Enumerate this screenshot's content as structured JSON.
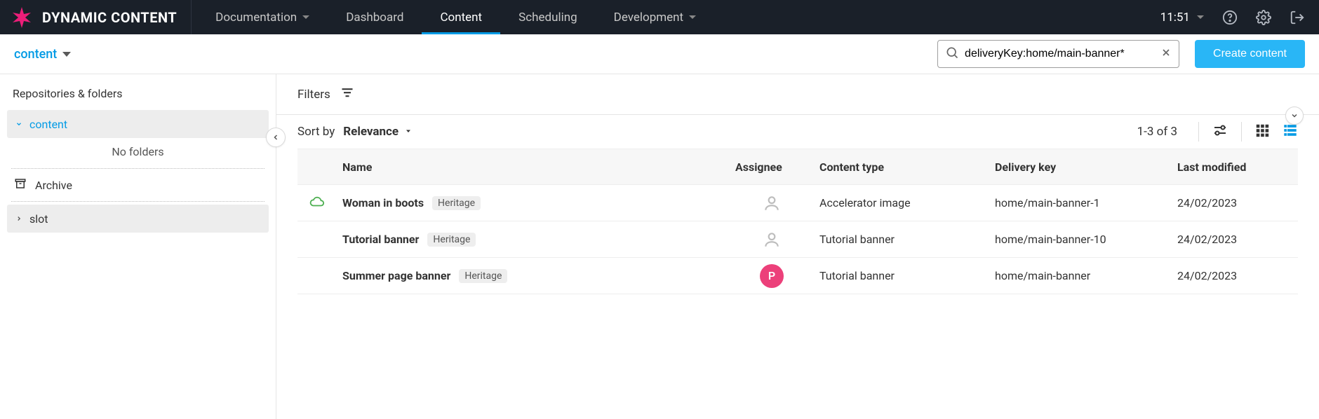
{
  "topbar": {
    "app_name": "DYNAMIC CONTENT",
    "nav": {
      "documentation": "Documentation",
      "dashboard": "Dashboard",
      "content": "Content",
      "scheduling": "Scheduling",
      "development": "Development"
    },
    "clock": "11:51"
  },
  "subheader": {
    "hub_label": "content",
    "search_value": "deliveryKey:home/main-banner*",
    "create_label": "Create content"
  },
  "sidebar": {
    "title": "Repositories & folders",
    "items": {
      "content": "content",
      "no_folders": "No folders",
      "archive": "Archive",
      "slot": "slot"
    }
  },
  "main": {
    "filters_label": "Filters",
    "sort_by_label": "Sort by",
    "sort_value": "Relevance",
    "count_label": "1-3 of 3",
    "columns": {
      "name": "Name",
      "assignee": "Assignee",
      "content_type": "Content type",
      "delivery_key": "Delivery key",
      "last_modified": "Last modified"
    },
    "rows": [
      {
        "name": "Woman in boots",
        "tag": "Heritage",
        "has_cloud": true,
        "assignee_letter": "",
        "content_type": "Accelerator image",
        "delivery_key": "home/main-banner-1",
        "last_modified": "24/02/2023"
      },
      {
        "name": "Tutorial banner",
        "tag": "Heritage",
        "has_cloud": false,
        "assignee_letter": "",
        "content_type": "Tutorial banner",
        "delivery_key": "home/main-banner-10",
        "last_modified": "24/02/2023"
      },
      {
        "name": "Summer page banner",
        "tag": "Heritage",
        "has_cloud": false,
        "assignee_letter": "P",
        "content_type": "Tutorial banner",
        "delivery_key": "home/main-banner",
        "last_modified": "24/02/2023"
      }
    ]
  }
}
